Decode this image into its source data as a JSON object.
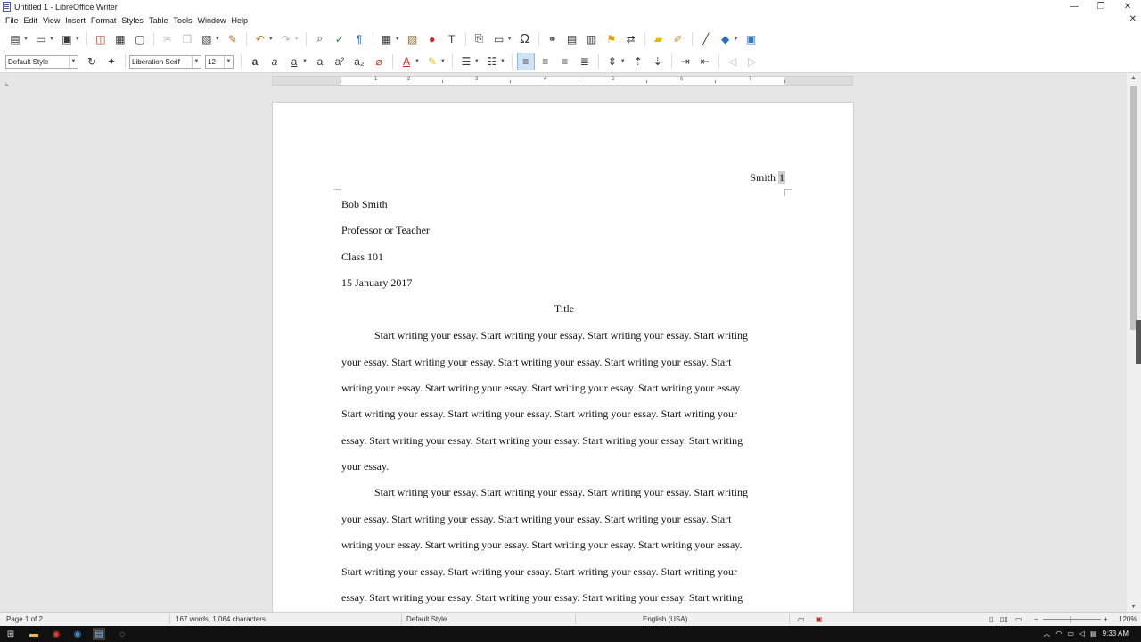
{
  "window": {
    "title": "Untitled 1 - LibreOffice Writer",
    "minimize": "—",
    "restore": "❐",
    "close": "✕"
  },
  "menu": [
    "File",
    "Edit",
    "View",
    "Insert",
    "Format",
    "Styles",
    "Table",
    "Tools",
    "Window",
    "Help"
  ],
  "menu_close": "✕",
  "toolbar": {
    "paragraph_style": "Default Style",
    "font_name": "Liberation Serif",
    "font_size": "12"
  },
  "ruler": {
    "numbers": [
      "1",
      "2",
      "3",
      "4",
      "5",
      "6",
      "7"
    ]
  },
  "document": {
    "header_name": "Smith ",
    "header_page": "1",
    "lines": [
      "Bob Smith",
      "Professor or Teacher",
      "Class 101",
      "15 January 2017"
    ],
    "title": "Title",
    "paragraph1": [
      "Start writing your essay. Start writing your essay. Start writing your essay. Start writing",
      "your essay. Start writing your essay. Start writing your essay. Start writing your essay. Start",
      "writing your essay. Start writing your essay. Start writing your essay. Start writing your essay.",
      "Start writing your essay. Start writing your essay. Start writing your essay. Start writing your",
      "essay. Start writing your essay. Start writing your essay. Start writing your essay. Start writing",
      "your essay."
    ],
    "paragraph2": [
      "Start writing your essay. Start writing your essay. Start writing your essay. Start writing",
      "your essay. Start writing your essay. Start writing your essay. Start writing your essay. Start",
      "writing your essay. Start writing your essay. Start writing your essay. Start writing your essay.",
      "Start writing your essay. Start writing your essay. Start writing your essay. Start writing your",
      "essay. Start writing your essay. Start writing your essay. Start writing your essay. Start writing"
    ]
  },
  "status": {
    "page": "Page 1 of 2",
    "words": "167 words, 1,064 characters",
    "style": "Default Style",
    "language": "English (USA)",
    "zoom": "120%"
  },
  "taskbar": {
    "time": "9:33 AM"
  }
}
